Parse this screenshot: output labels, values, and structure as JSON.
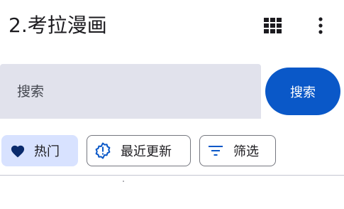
{
  "app_bar": {
    "title": "2.考拉漫画",
    "actions": [
      {
        "icon": "grid-view-icon"
      },
      {
        "icon": "more-vert-icon"
      }
    ]
  },
  "search": {
    "placeholder": "搜索",
    "value": "",
    "button_label": "搜索"
  },
  "chips": [
    {
      "label": "热门",
      "icon": "heart-icon",
      "selected": true
    },
    {
      "label": "最近更新",
      "icon": "new-releases-icon",
      "selected": false
    },
    {
      "label": "筛选",
      "icon": "filter-icon",
      "selected": false
    }
  ],
  "colors": {
    "primary": "#0a58c8",
    "selected_chip": "#d8e2ff",
    "search_bg": "#e1e2ec",
    "icon": "#0a3a8c",
    "outline": "#75777f"
  }
}
